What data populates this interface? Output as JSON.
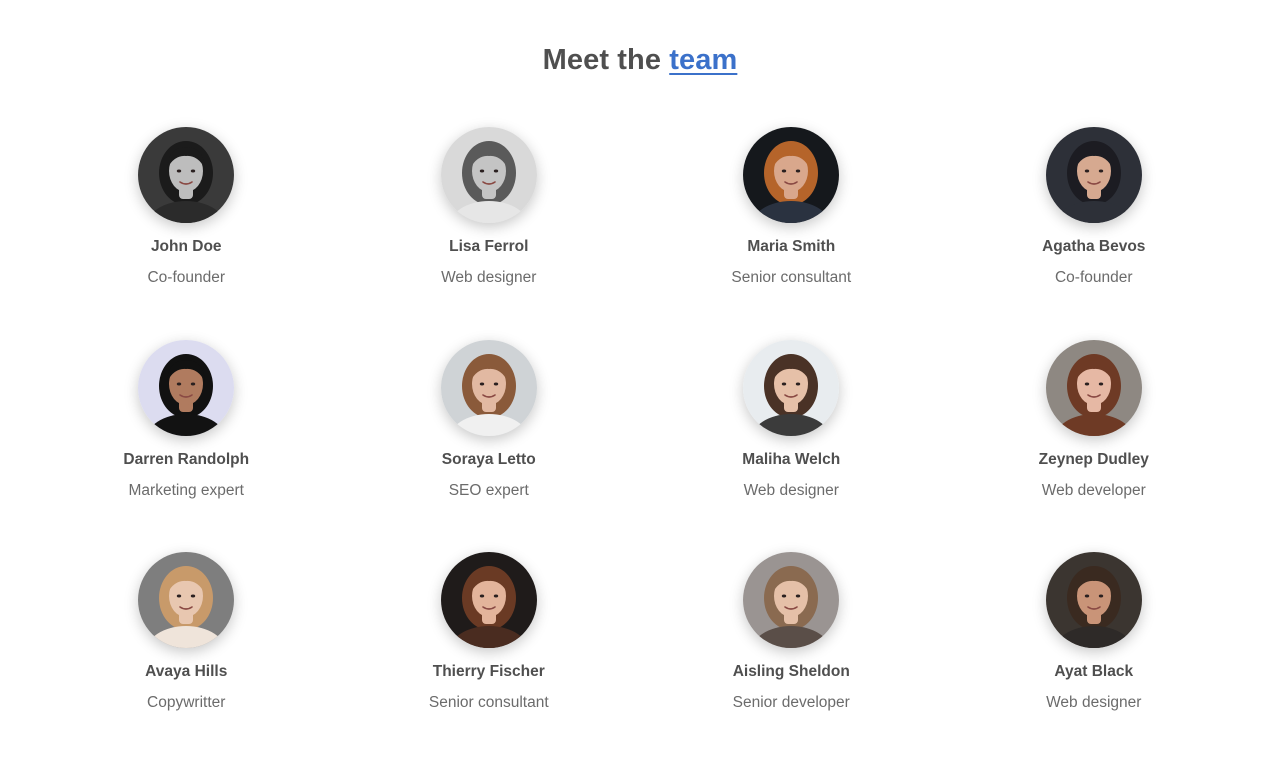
{
  "heading": {
    "prefix": "Meet the ",
    "link": "team"
  },
  "team": [
    {
      "name": "John Doe",
      "role": "Co-founder",
      "avatar_icon": "person-photo-icon",
      "bg": "#3a3a3a",
      "skin": "#bdbdbd",
      "hair": "#1b1b1b",
      "shirt": "#2b2b2b"
    },
    {
      "name": "Lisa Ferrol",
      "role": "Web designer",
      "avatar_icon": "person-photo-icon",
      "bg": "#d9d9d9",
      "skin": "#c4c4c4",
      "hair": "#5a5a5a",
      "shirt": "#e6e6e6"
    },
    {
      "name": "Maria Smith",
      "role": "Senior consultant",
      "avatar_icon": "person-photo-icon",
      "bg": "#15181c",
      "skin": "#d9a78c",
      "hair": "#b5642a",
      "shirt": "#2a3240"
    },
    {
      "name": "Agatha Bevos",
      "role": "Co-founder",
      "avatar_icon": "person-photo-icon",
      "bg": "#2d3038",
      "skin": "#d6a990",
      "hair": "#1c1c22",
      "shirt": "#2d3038"
    },
    {
      "name": "Darren Randolph",
      "role": "Marketing expert",
      "avatar_icon": "person-photo-icon",
      "bg": "#dcdcf0",
      "skin": "#b07b5f",
      "hair": "#111111",
      "shirt": "#121212"
    },
    {
      "name": "Soraya Letto",
      "role": "SEO expert",
      "avatar_icon": "person-photo-icon",
      "bg": "#cfd3d6",
      "skin": "#e2b9a2",
      "hair": "#8a5a3a",
      "shirt": "#f0f0f0"
    },
    {
      "name": "Maliha Welch",
      "role": "Web designer",
      "avatar_icon": "person-photo-icon",
      "bg": "#e8ecef",
      "skin": "#e6c0a8",
      "hair": "#4a3226",
      "shirt": "#3b3b3b"
    },
    {
      "name": "Zeynep Dudley",
      "role": "Web developer",
      "avatar_icon": "person-photo-icon",
      "bg": "#8e8882",
      "skin": "#e6b8a4",
      "hair": "#6e3a25",
      "shirt": "#6e3a25"
    },
    {
      "name": "Avaya Hills",
      "role": "Copywritter",
      "avatar_icon": "person-photo-icon",
      "bg": "#7e7e7e",
      "skin": "#e8c7b0",
      "hair": "#c89a6a",
      "shirt": "#efe4da"
    },
    {
      "name": "Thierry Fischer",
      "role": "Senior consultant",
      "avatar_icon": "person-photo-icon",
      "bg": "#1f1b1a",
      "skin": "#e3b49b",
      "hair": "#6a3a24",
      "shirt": "#4a2c20"
    },
    {
      "name": "Aisling Sheldon",
      "role": "Senior developer",
      "avatar_icon": "person-photo-icon",
      "bg": "#9a9492",
      "skin": "#e5c0a8",
      "hair": "#8a6a50",
      "shirt": "#5a4e48"
    },
    {
      "name": "Ayat Black",
      "role": "Web designer",
      "avatar_icon": "person-photo-icon",
      "bg": "#3b3530",
      "skin": "#c99478",
      "hair": "#3a2a20",
      "shirt": "#2e2a28"
    }
  ]
}
